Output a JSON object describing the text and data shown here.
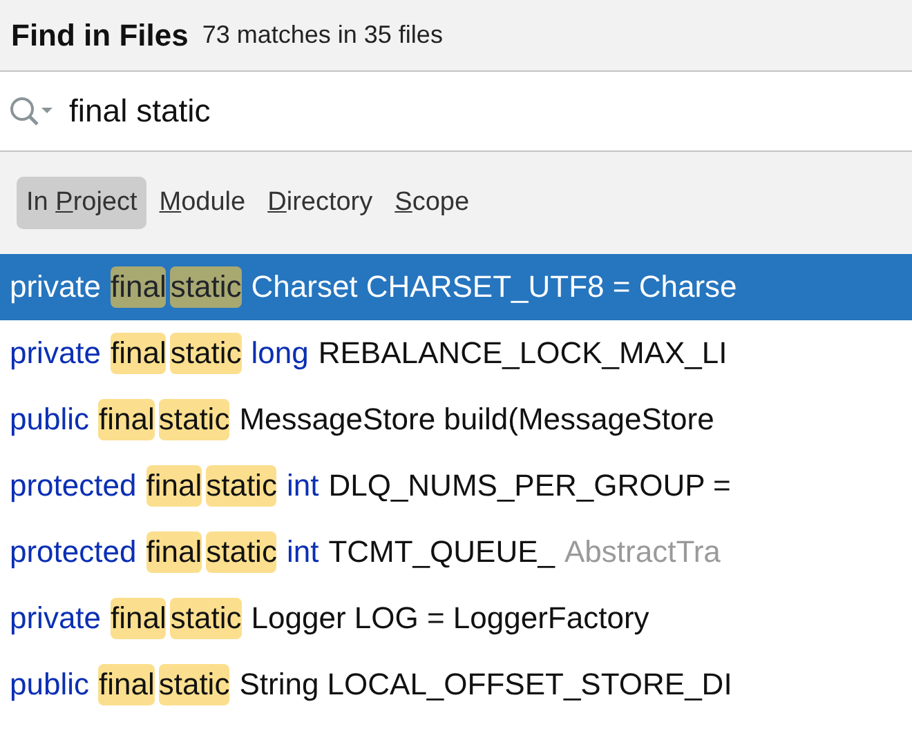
{
  "header": {
    "title": "Find in Files",
    "summary": "73 matches in 35 files"
  },
  "search": {
    "value": "final static"
  },
  "scopes": [
    {
      "pre": "In ",
      "key": "P",
      "post": "roject",
      "selected": true
    },
    {
      "key": "M",
      "post": "odule",
      "selected": false
    },
    {
      "key": "D",
      "post": "irectory",
      "selected": false
    },
    {
      "key": "S",
      "post": "cope",
      "selected": false
    }
  ],
  "results": [
    {
      "selected": true,
      "segments": [
        {
          "kind": "keyword",
          "text": "private"
        },
        {
          "kind": "match",
          "text": "final"
        },
        {
          "kind": "match",
          "text": "static"
        },
        {
          "kind": "plain",
          "text": "Charset CHARSET_UTF8 = Charse"
        }
      ]
    },
    {
      "selected": false,
      "segments": [
        {
          "kind": "keyword",
          "text": "private"
        },
        {
          "kind": "match",
          "text": "final"
        },
        {
          "kind": "match",
          "text": "static"
        },
        {
          "kind": "keyword",
          "text": "long"
        },
        {
          "kind": "plain",
          "text": "REBALANCE_LOCK_MAX_LI"
        }
      ]
    },
    {
      "selected": false,
      "segments": [
        {
          "kind": "keyword",
          "text": "public"
        },
        {
          "kind": "match",
          "text": "final"
        },
        {
          "kind": "match",
          "text": "static"
        },
        {
          "kind": "plain",
          "text": "MessageStore build(MessageStore"
        }
      ]
    },
    {
      "selected": false,
      "segments": [
        {
          "kind": "keyword",
          "text": "protected"
        },
        {
          "kind": "match",
          "text": "final"
        },
        {
          "kind": "match",
          "text": "static"
        },
        {
          "kind": "keyword",
          "text": "int"
        },
        {
          "kind": "plain",
          "text": "DLQ_NUMS_PER_GROUP ="
        }
      ]
    },
    {
      "selected": false,
      "segments": [
        {
          "kind": "keyword",
          "text": "protected"
        },
        {
          "kind": "match",
          "text": "final"
        },
        {
          "kind": "match",
          "text": "static"
        },
        {
          "kind": "keyword",
          "text": "int"
        },
        {
          "kind": "plain",
          "text": "TCMT_QUEUE_"
        },
        {
          "kind": "file",
          "text": "AbstractTra"
        }
      ]
    },
    {
      "selected": false,
      "segments": [
        {
          "kind": "keyword",
          "text": "private"
        },
        {
          "kind": "match",
          "text": "final"
        },
        {
          "kind": "match",
          "text": "static"
        },
        {
          "kind": "plain",
          "text": "Logger LOG = LoggerFactory"
        }
      ]
    },
    {
      "selected": false,
      "segments": [
        {
          "kind": "keyword",
          "text": "public"
        },
        {
          "kind": "match",
          "text": "final"
        },
        {
          "kind": "match",
          "text": "static"
        },
        {
          "kind": "plain",
          "text": "String LOCAL_OFFSET_STORE_DI"
        }
      ]
    }
  ]
}
